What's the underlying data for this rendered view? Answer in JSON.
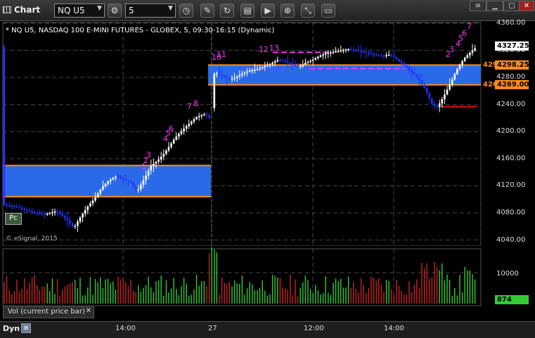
{
  "toolbar": {
    "window_title": "Chart",
    "symbol": "NQ U5",
    "interval": "5"
  },
  "chart": {
    "info_line": "* NQ U5, NASDAQ 100 E-MINI FUTURES - GLOBEX, 5, 09:30-16:15 (Dynamic)",
    "copyright": "© eSignal, 2015",
    "pc_button": "Pc",
    "price_ticks": [
      "4360.00",
      "4320.00",
      "4280.00",
      "4240.00",
      "4200.00",
      "4160.00",
      "4120.00",
      "4080.00",
      "4040.00"
    ],
    "price_tags": {
      "last": "4327.25",
      "upper_zone": "4298.25",
      "lower_zone": "4269.00",
      "left_upper": "429",
      "left_lower": "426"
    },
    "volume_ticks": [
      "10000"
    ],
    "volume_tag": "874",
    "volume_label": "Vol (current price bar)",
    "time_ticks": [
      "14:00",
      "27",
      "12:00",
      "14:00"
    ],
    "bottom_label": "Dyn",
    "colors": {
      "zone_fill": "#2a6ae8",
      "zone_border": "#ff8c1a",
      "up_bar": "#ffffff",
      "down_bar": "#2233ff",
      "seq_magenta": "#ff33ff",
      "seq_green": "#33cc33",
      "vol_up": "#33cc33",
      "vol_down": "#cc2222",
      "last_tag": "#ffffff",
      "volume_tag_bg": "#33cc33"
    },
    "sequential_labels": [
      {
        "text": "1",
        "color": "magenta"
      },
      {
        "text": "2",
        "color": "magenta"
      },
      {
        "text": "3",
        "color": "magenta"
      },
      {
        "text": "4",
        "color": "magenta"
      },
      {
        "text": "5",
        "color": "magenta"
      },
      {
        "text": "6",
        "color": "magenta"
      },
      {
        "text": "7",
        "color": "magenta"
      },
      {
        "text": "8",
        "color": "magenta"
      },
      {
        "text": "10",
        "color": "magenta"
      },
      {
        "text": "11",
        "color": "magenta"
      },
      {
        "text": "12",
        "color": "magenta"
      },
      {
        "text": "13",
        "color": "magenta"
      },
      {
        "text": "2",
        "color": "magenta"
      },
      {
        "text": "3",
        "color": "magenta"
      },
      {
        "text": "4",
        "color": "magenta"
      },
      {
        "text": "5",
        "color": "magenta"
      },
      {
        "text": "6",
        "color": "magenta"
      },
      {
        "text": "7",
        "color": "magenta"
      }
    ]
  }
}
